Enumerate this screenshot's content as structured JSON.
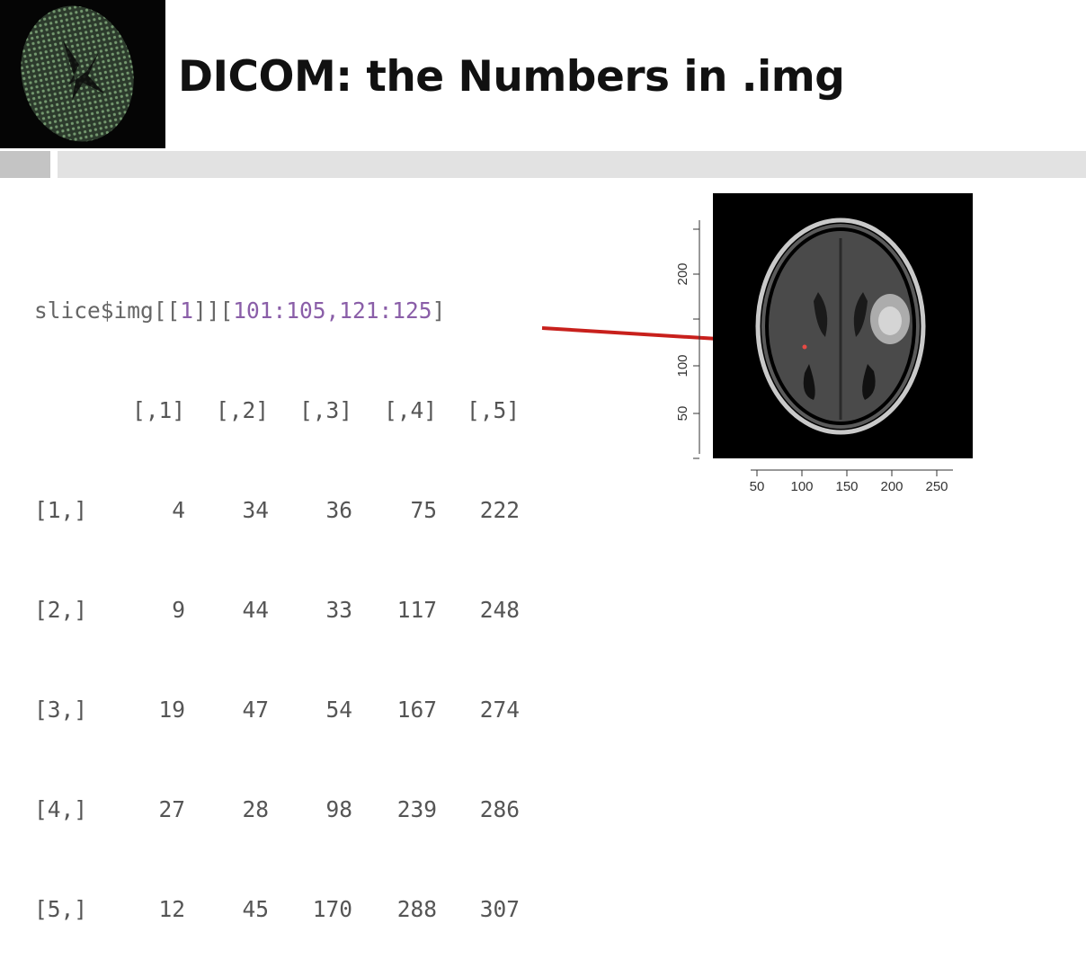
{
  "slide": {
    "title": "DICOM: the Numbers in .img"
  },
  "code": {
    "command_prefix": "slice$img[[",
    "command_index": "1",
    "command_mid": "]][",
    "command_range": "101:105,121:125",
    "command_suffix": "]",
    "col_headers": [
      "[,1]",
      "[,2]",
      "[,3]",
      "[,4]",
      "[,5]"
    ],
    "rows": [
      {
        "label": "[1,]",
        "values": [
          "4",
          "34",
          "36",
          "75",
          "222"
        ]
      },
      {
        "label": "[2,]",
        "values": [
          "9",
          "44",
          "33",
          "117",
          "248"
        ]
      },
      {
        "label": "[3,]",
        "values": [
          "19",
          "47",
          "54",
          "167",
          "274"
        ]
      },
      {
        "label": "[4,]",
        "values": [
          "27",
          "28",
          "98",
          "239",
          "286"
        ]
      },
      {
        "label": "[5,]",
        "values": [
          "12",
          "45",
          "170",
          "288",
          "307"
        ]
      }
    ]
  },
  "plot": {
    "x_ticks": [
      "50",
      "100",
      "150",
      "200",
      "250"
    ],
    "y_ticks": [
      "50",
      "100",
      "200"
    ]
  },
  "colors": {
    "arrow": "#c8201c",
    "code_purple": "#8a5ea8",
    "code_gray": "#555555",
    "band": "#e2e2e2",
    "band_accent": "#c4c4c4"
  }
}
